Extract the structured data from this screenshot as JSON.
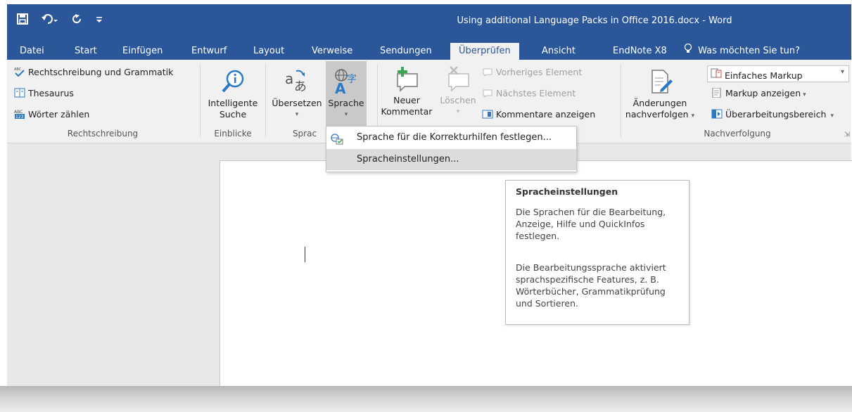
{
  "window": {
    "title": "Using additional Language Packs in Office 2016.docx - Word"
  },
  "qat": {
    "save": "save-icon",
    "undo": "undo-icon",
    "redo": "redo-icon",
    "customize": "customize-icon"
  },
  "tabs": [
    {
      "label": "Datei"
    },
    {
      "label": "Start"
    },
    {
      "label": "Einfügen"
    },
    {
      "label": "Entwurf"
    },
    {
      "label": "Layout"
    },
    {
      "label": "Verweise"
    },
    {
      "label": "Sendungen"
    },
    {
      "label": "Überprüfen"
    },
    {
      "label": "Ansicht"
    },
    {
      "label": "EndNote X8"
    }
  ],
  "tell_me": "Was möchten Sie tun?",
  "ribbon": {
    "rechtschreibung": {
      "spelling": "Rechtschreibung und Grammatik",
      "thesaurus": "Thesaurus",
      "wordcount": "Wörter zählen",
      "label": "Rechtschreibung"
    },
    "einblicke": {
      "smart1": "Intelligente",
      "smart2": "Suche",
      "label": "Einblicke"
    },
    "sprache": {
      "translate": "Übersetzen",
      "language": "Sprache",
      "label": "Sprac"
    },
    "kommentare": {
      "new1": "Neuer",
      "new2": "Kommentar",
      "delete": "Löschen",
      "prev": "Vorheriges Element",
      "next": "Nächstes Element",
      "show": "Kommentare anzeigen"
    },
    "nachverfolgung": {
      "track1": "Änderungen",
      "track2": "nachverfolgen",
      "markup_select": "Einfaches Markup",
      "show_markup": "Markup anzeigen",
      "review_pane": "Überarbeitungsbereich",
      "label": "Nachverfolgung"
    }
  },
  "menu": {
    "item1": "Sprache für die Korrekturhilfen festlegen...",
    "item2": "Spracheinstellungen..."
  },
  "tooltip": {
    "title": "Spracheinstellungen",
    "lines1": [
      "Die Sprachen für die Bearbeitung,",
      "Anzeige, Hilfe und QuickInfos",
      "festlegen."
    ],
    "lines2": [
      "Die Bearbeitungssprache aktiviert",
      "sprachspezifische Features, z. B.",
      "Wörterbücher, Grammatikprüfung",
      "und Sortieren."
    ]
  },
  "colors": {
    "accent": "#2b579a",
    "ribbon": "#f1f1f1"
  }
}
